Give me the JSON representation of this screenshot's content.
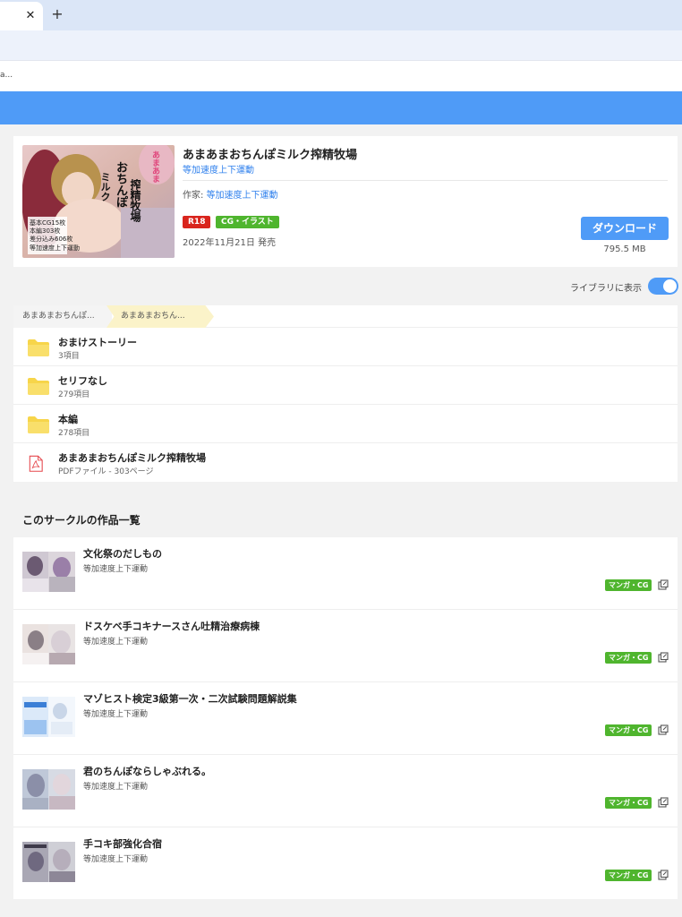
{
  "browser": {
    "tab_close": "✕",
    "new_tab": "+",
    "bookmark_text": "a..."
  },
  "product": {
    "title": "あまあまおちんぽミルク搾精牧場",
    "circle": "等加速度上下運動",
    "author_label": "作家: ",
    "author": "等加速度上下運動",
    "badge_rating": "R18",
    "badge_genre": "CG・イラスト",
    "release": "2022年11月21日 発売",
    "download_label": "ダウンロード",
    "size": "795.5 MB",
    "cover_text": [
      "おちんぽ",
      "搾精牧場",
      "ミルク",
      "あまあま",
      "基本CG15枚",
      "本編303枚",
      "差分込み606枚",
      "等加速度上下運動"
    ]
  },
  "library": {
    "label": "ライブラリに表示",
    "enabled": true
  },
  "breadcrumb": [
    "あまあまおちんぽ...",
    "あまあまおちん..."
  ],
  "files": [
    {
      "name": "おまけストーリー",
      "meta": "3項目",
      "icon": "folder-icon"
    },
    {
      "name": "セリフなし",
      "meta": "279項目",
      "icon": "folder-icon"
    },
    {
      "name": "本編",
      "meta": "278項目",
      "icon": "folder-icon"
    },
    {
      "name": "あまあまおちんぽミルク搾精牧場",
      "meta": "PDFファイル - 303ページ",
      "icon": "pdf-icon"
    }
  ],
  "circle_works": {
    "title": "このサークルの作品一覧",
    "items": [
      {
        "title": "文化祭のだしもの",
        "circle": "等加速度上下運動",
        "tag": "マンガ・CG"
      },
      {
        "title": "ドスケベ手コキナースさん吐精治療病棟",
        "circle": "等加速度上下運動",
        "tag": "マンガ・CG"
      },
      {
        "title": "マゾヒスト検定3級第一次・二次試験問題解説集",
        "circle": "等加速度上下運動",
        "tag": "マンガ・CG"
      },
      {
        "title": "君のちんぽならしゃぶれる。",
        "circle": "等加速度上下運動",
        "tag": "マンガ・CG"
      },
      {
        "title": "手コキ部強化合宿",
        "circle": "等加速度上下運動",
        "tag": "マンガ・CG"
      }
    ]
  },
  "colors": {
    "accent": "#4f9bf7",
    "link": "#2f80ed",
    "r18": "#d9251d",
    "genre": "#4fb52e",
    "folder": "#f7d54a",
    "pdf": "#e5484d"
  }
}
